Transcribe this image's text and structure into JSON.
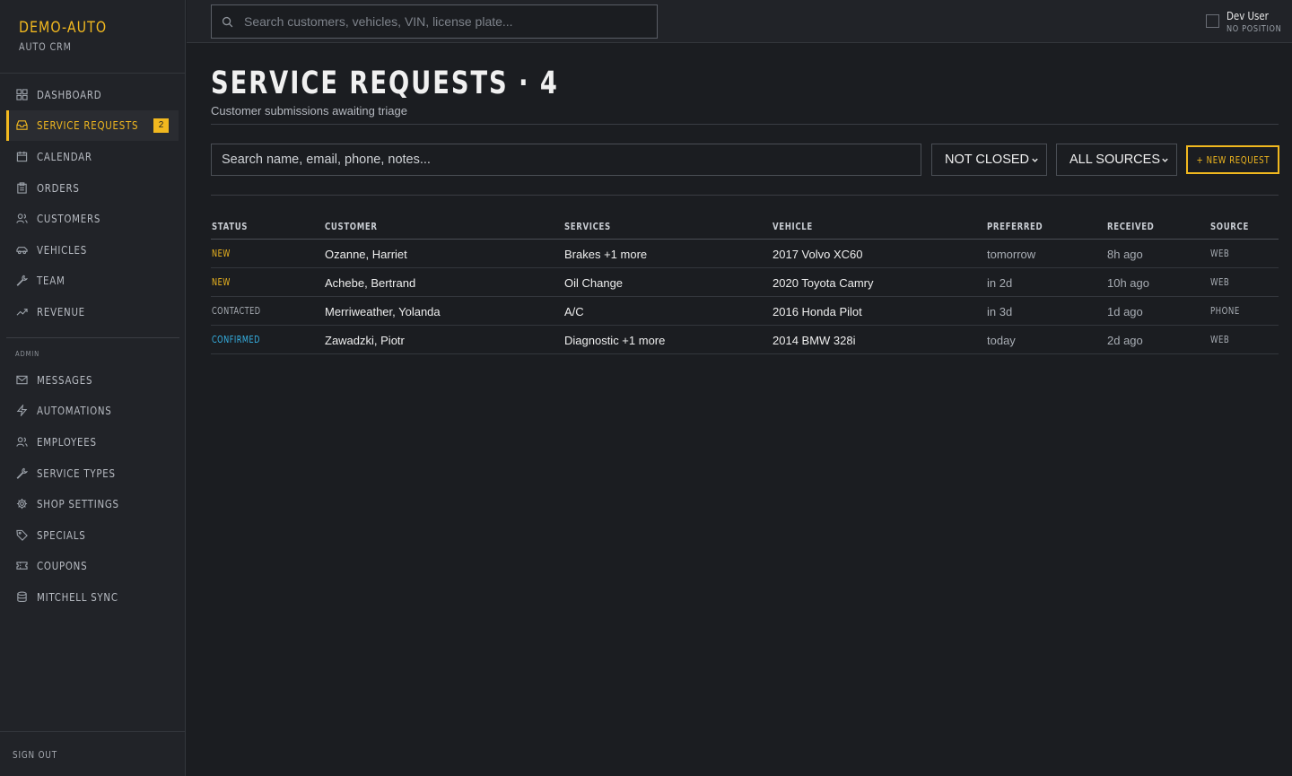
{
  "brand": {
    "name": "DEMO-AUTO",
    "subtitle": "AUTO CRM"
  },
  "sidebar": {
    "items": [
      {
        "label": "DASHBOARD",
        "icon": "grid-icon"
      },
      {
        "label": "SERVICE REQUESTS",
        "icon": "inbox-icon",
        "active": true,
        "badge": "2"
      },
      {
        "label": "CALENDAR",
        "icon": "calendar-icon"
      },
      {
        "label": "ORDERS",
        "icon": "clipboard-icon"
      },
      {
        "label": "CUSTOMERS",
        "icon": "users-icon"
      },
      {
        "label": "VEHICLES",
        "icon": "car-icon"
      },
      {
        "label": "TEAM",
        "icon": "wrench-icon"
      },
      {
        "label": "REVENUE",
        "icon": "trending-up-icon"
      }
    ],
    "admin_label": "ADMIN",
    "admin_items": [
      {
        "label": "MESSAGES",
        "icon": "mail-icon"
      },
      {
        "label": "AUTOMATIONS",
        "icon": "bolt-icon"
      },
      {
        "label": "EMPLOYEES",
        "icon": "user-icon"
      },
      {
        "label": "SERVICE TYPES",
        "icon": "wrench-icon"
      },
      {
        "label": "SHOP SETTINGS",
        "icon": "gear-icon"
      },
      {
        "label": "SPECIALS",
        "icon": "tag-icon"
      },
      {
        "label": "COUPONS",
        "icon": "ticket-icon"
      },
      {
        "label": "MITCHELL SYNC",
        "icon": "database-icon"
      }
    ],
    "sign_out": "SIGN OUT"
  },
  "topbar": {
    "search_placeholder": "Search customers, vehicles, VIN, license plate...",
    "user_name": "Dev User",
    "user_position": "NO POSITION"
  },
  "page": {
    "title": "SERVICE REQUESTS · 4",
    "subtitle": "Customer submissions awaiting triage"
  },
  "filters": {
    "search_placeholder": "Search name, email, phone, notes...",
    "status_selected": "NOT CLOSED",
    "source_selected": "ALL SOURCES",
    "new_button": "+ NEW REQUEST"
  },
  "table": {
    "columns": [
      "STATUS",
      "CUSTOMER",
      "SERVICES",
      "VEHICLE",
      "PREFERRED",
      "RECEIVED",
      "SOURCE"
    ],
    "rows": [
      {
        "status": "NEW",
        "customer": "Ozanne, Harriet",
        "services": "Brakes +1 more",
        "vehicle": "2017 Volvo XC60",
        "preferred": "tomorrow",
        "received": "8h ago",
        "source": "WEB"
      },
      {
        "status": "NEW",
        "customer": "Achebe, Bertrand",
        "services": "Oil Change",
        "vehicle": "2020 Toyota Camry",
        "preferred": "in 2d",
        "received": "10h ago",
        "source": "WEB"
      },
      {
        "status": "CONTACTED",
        "customer": "Merriweather, Yolanda",
        "services": "A/C",
        "vehicle": "2016 Honda Pilot",
        "preferred": "in 3d",
        "received": "1d ago",
        "source": "PHONE"
      },
      {
        "status": "CONFIRMED",
        "customer": "Zawadzki, Piotr",
        "services": "Diagnostic +1 more",
        "vehicle": "2014 BMW 328i",
        "preferred": "today",
        "received": "2d ago",
        "source": "WEB"
      }
    ]
  },
  "colors": {
    "accent": "#f1b81f",
    "status_new": "#f1b81f",
    "status_contacted": "#a8adb4",
    "status_confirmed": "#36b3e6"
  }
}
